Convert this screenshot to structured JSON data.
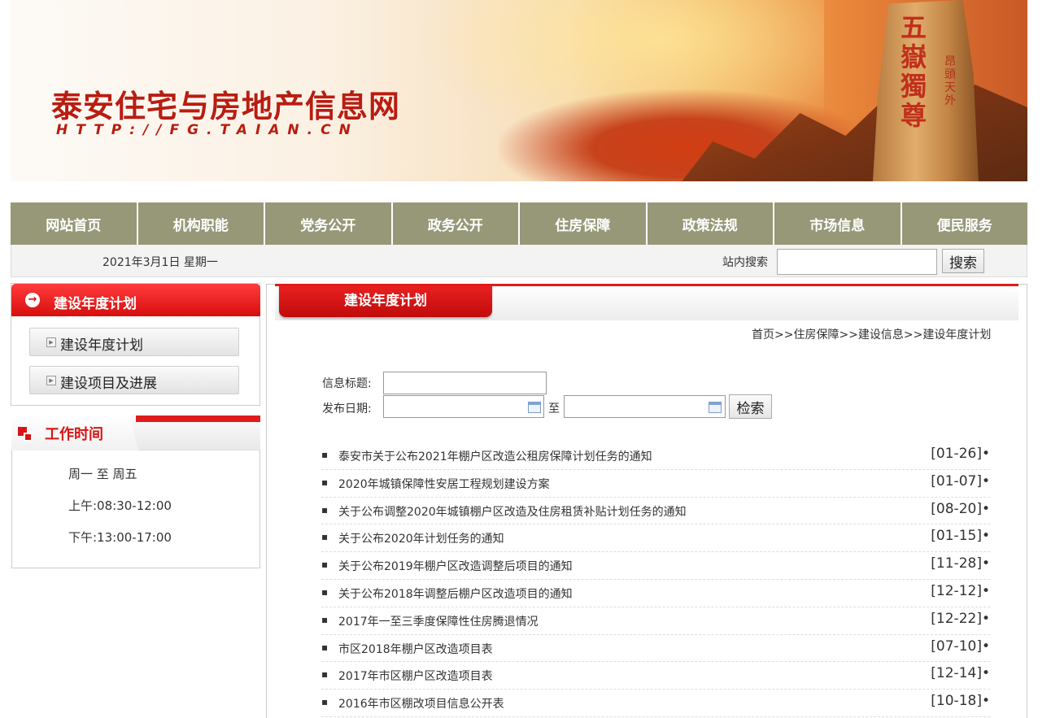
{
  "banner": {
    "title": "泰安住宅与房地产信息网",
    "url": "HTTP://FG.TAIAN.CN",
    "rock_text": "五嶽獨尊",
    "rock_small": "昂頭天外"
  },
  "nav": {
    "items": [
      "网站首页",
      "机构职能",
      "党务公开",
      "政务公开",
      "住房保障",
      "政策法规",
      "市场信息",
      "便民服务"
    ]
  },
  "infobar": {
    "date": "2021年3月1日 星期一",
    "search_label": "站内搜索",
    "search_value": "",
    "search_button": "搜索"
  },
  "sidebar": {
    "heading": "建设年度计划",
    "links": [
      "建设年度计划",
      "建设项目及进展"
    ],
    "work": {
      "heading": "工作时间",
      "lines": [
        "周一 至 周五",
        "上午:08:30-12:00",
        "下午:13:00-17:00"
      ]
    }
  },
  "main": {
    "tab": "建设年度计划",
    "breadcrumb": "首页>>住房保障>>建设信息>>建设年度计划",
    "form": {
      "title_label": "信息标题:",
      "date_label": "发布日期:",
      "to_label": "至",
      "button": "检索"
    },
    "items": [
      {
        "title": "泰安市关于公布2021年棚户区改造公租房保障计划任务的通知",
        "date": "[01-26]•"
      },
      {
        "title": "2020年城镇保障性安居工程规划建设方案",
        "date": "[01-07]•"
      },
      {
        "title": "关于公布调整2020年城镇棚户区改造及住房租赁补贴计划任务的通知",
        "date": "[08-20]•"
      },
      {
        "title": "关于公布2020年计划任务的通知",
        "date": "[01-15]•"
      },
      {
        "title": "关于公布2019年棚户区改造调整后项目的通知",
        "date": "[11-28]•"
      },
      {
        "title": "关于公布2018年调整后棚户区改造项目的通知",
        "date": "[12-12]•"
      },
      {
        "title": "2017年一至三季度保障性住房腾退情况",
        "date": "[12-22]•"
      },
      {
        "title": "市区2018年棚户区改造项目表",
        "date": "[07-10]•"
      },
      {
        "title": "2017年市区棚户区改造项目表",
        "date": "[12-14]•"
      },
      {
        "title": "2016年市区棚改项目信息公开表",
        "date": "[10-18]•"
      }
    ]
  }
}
